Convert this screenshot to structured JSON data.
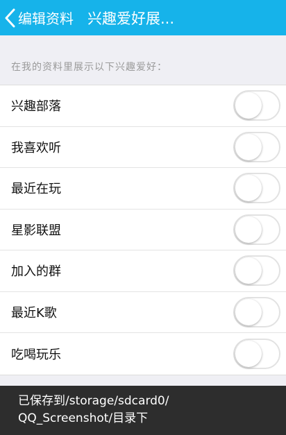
{
  "header": {
    "back_label": "编辑资料",
    "title": "兴趣爱好展..."
  },
  "caption": "在我的资料里展示以下兴趣爱好：",
  "items": [
    {
      "label": "兴趣部落",
      "enabled": false
    },
    {
      "label": "我喜欢听",
      "enabled": false
    },
    {
      "label": "最近在玩",
      "enabled": false
    },
    {
      "label": "星影联盟",
      "enabled": false
    },
    {
      "label": "加入的群",
      "enabled": false
    },
    {
      "label": "最近K歌",
      "enabled": false
    },
    {
      "label": "吃喝玩乐",
      "enabled": false
    }
  ],
  "toast": {
    "line1": "已保存到/storage/sdcard0/",
    "line2": "QQ_Screenshot/目录下"
  },
  "colors": {
    "header_bg": "#16b3ea",
    "page_bg": "#efeff4",
    "toast_bg": "#222222"
  },
  "icons": {
    "back": "chevron-left-icon"
  }
}
